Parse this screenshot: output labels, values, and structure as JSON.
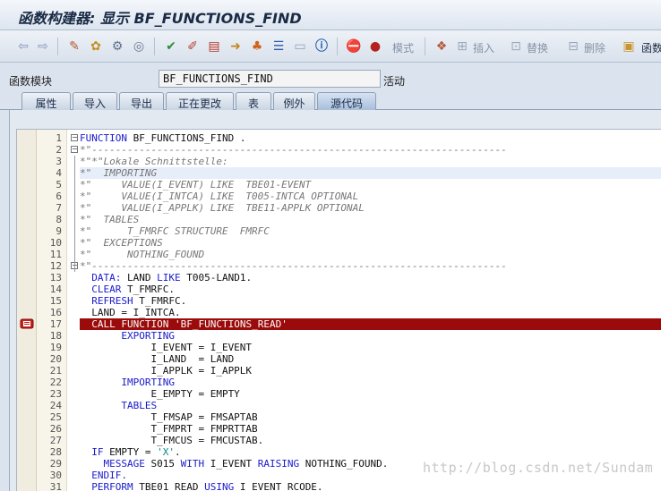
{
  "window": {
    "title": "函数构建器: 显示 BF_FUNCTIONS_FIND"
  },
  "toolbar": {
    "mode_label": "模式",
    "insert_label": "插入",
    "replace_label": "替换",
    "delete_label": "删除",
    "func_label": "函数"
  },
  "function_module": {
    "label": "函数模块",
    "value": "BF_FUNCTIONS_FIND",
    "status": "活动"
  },
  "tabs": [
    "属性",
    "导入",
    "导出",
    "正在更改",
    "表",
    "例外",
    "源代码"
  ],
  "active_tab": "源代码",
  "code": {
    "lines": [
      {
        "n": "1",
        "t": "FUNCTION BF_FUNCTIONS_FIND ."
      },
      {
        "n": "2",
        "t": "*\"----------------------------------------------------------------------"
      },
      {
        "n": "3",
        "t": "*\"*\"Lokale Schnittstelle:"
      },
      {
        "n": "4",
        "t": "*\"  IMPORTING"
      },
      {
        "n": "5",
        "t": "*\"     VALUE(I_EVENT) LIKE  TBE01-EVENT"
      },
      {
        "n": "6",
        "t": "*\"     VALUE(I_INTCA) LIKE  T005-INTCA OPTIONAL"
      },
      {
        "n": "7",
        "t": "*\"     VALUE(I_APPLK) LIKE  TBE11-APPLK OPTIONAL"
      },
      {
        "n": "8",
        "t": "*\"  TABLES"
      },
      {
        "n": "9",
        "t": "*\"      T_FMRFC STRUCTURE  FMRFC"
      },
      {
        "n": "10",
        "t": "*\"  EXCEPTIONS"
      },
      {
        "n": "11",
        "t": "*\"      NOTHING_FOUND"
      },
      {
        "n": "12",
        "t": "*\"----------------------------------------------------------------------"
      },
      {
        "n": "13",
        "t": "  DATA: LAND LIKE T005-LAND1."
      },
      {
        "n": "14",
        "t": "  CLEAR T_FMRFC."
      },
      {
        "n": "15",
        "t": "  REFRESH T_FMRFC."
      },
      {
        "n": "16",
        "t": "  LAND = I_INTCA."
      },
      {
        "n": "17",
        "t": "  CALL FUNCTION 'BF_FUNCTIONS_READ'"
      },
      {
        "n": "18",
        "t": "       EXPORTING"
      },
      {
        "n": "19",
        "t": "            I_EVENT = I_EVENT"
      },
      {
        "n": "20",
        "t": "            I_LAND  = LAND"
      },
      {
        "n": "21",
        "t": "            I_APPLK = I_APPLK"
      },
      {
        "n": "22",
        "t": "       IMPORTING"
      },
      {
        "n": "23",
        "t": "            E_EMPTY = EMPTY"
      },
      {
        "n": "24",
        "t": "       TABLES"
      },
      {
        "n": "25",
        "t": "            T_FMSAP = FMSAPTAB"
      },
      {
        "n": "26",
        "t": "            T_FMPRT = FMPRTTAB"
      },
      {
        "n": "27",
        "t": "            T_FMCUS = FMCUSTAB."
      },
      {
        "n": "28",
        "t": "  IF EMPTY = 'X'."
      },
      {
        "n": "29",
        "t": "    MESSAGE S015 WITH I_EVENT RAISING NOTHING_FOUND."
      },
      {
        "n": "30",
        "t": "  ENDIF."
      },
      {
        "n": "31",
        "t": "  PERFORM TBE01_READ USING I_EVENT RCODE."
      }
    ],
    "highlighted_line": "17",
    "cursor_line": "4",
    "breakpoint_line": "17"
  },
  "watermark": "http://blog.csdn.net/Sundam",
  "colors": {
    "highlight": "#9b0b0b",
    "keyword": "#1a1acc",
    "comment": "#777777"
  }
}
